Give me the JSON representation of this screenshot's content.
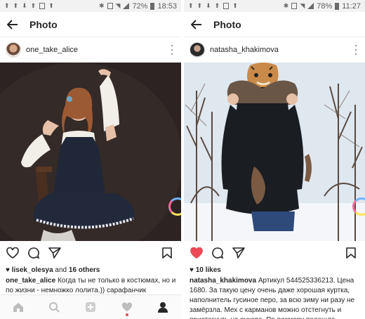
{
  "left": {
    "status": {
      "battery": "72%",
      "time": "18:53"
    },
    "appbar": {
      "title": "Photo"
    },
    "post": {
      "username": "one_take_alice",
      "likes_user": "lisek_olesya",
      "likes_and": " and ",
      "likes_others": "16 others",
      "caption_user": "one_take_alice",
      "caption_text": "Когда ты не только в костюмах, но и по жизни - немножко лолита.)) сарафанчик"
    }
  },
  "right": {
    "status": {
      "battery": "78%",
      "time": "11:27"
    },
    "appbar": {
      "title": "Photo"
    },
    "post": {
      "username": "natasha_khakimova",
      "likes_count": "10 likes",
      "caption_user": "natasha_khakimova",
      "caption_text": "Артикул 544525336213. Цена 1680. За такую цену очень даже хорошая куртка, наполнитель гусиное перо, за всю зиму ни разу не замёрзла. Мех с карманов можно отстегнуть и пристегнуть на рукава. По размеру подошла"
    }
  },
  "icons": {
    "back": "arrow-left-icon",
    "more": "more-vertical-icon",
    "like": "heart-icon",
    "comment": "comment-icon",
    "share": "send-icon",
    "bookmark": "bookmark-icon",
    "home": "home-icon",
    "search": "search-icon",
    "add": "add-icon",
    "activity": "heart-icon",
    "profile": "profile-icon"
  },
  "colors": {
    "like_red": "#ed4956",
    "text": "#262626"
  }
}
